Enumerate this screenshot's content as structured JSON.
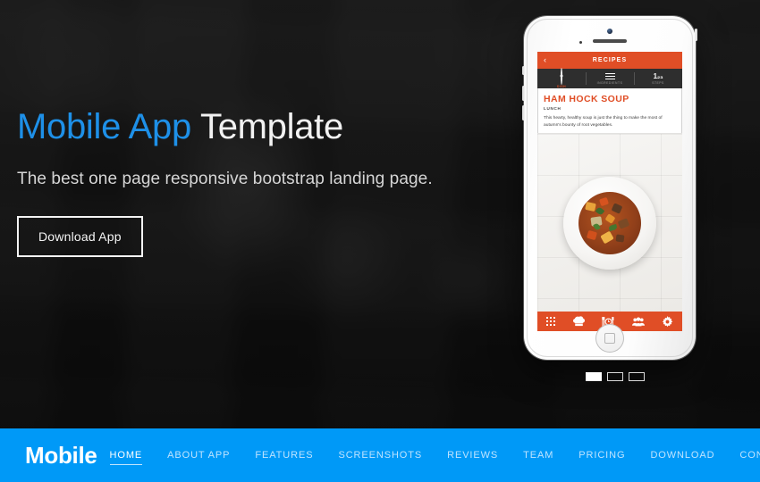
{
  "hero": {
    "headline_accent": "Mobile App",
    "headline_rest": " Template",
    "subheadline": "The best one page responsive bootstrap landing page.",
    "cta_label": "Download App",
    "accent_color": "#1e90e8",
    "background_style": "dark blurred grayscale photo collage"
  },
  "phone": {
    "app": {
      "topbar": {
        "back_icon": "‹",
        "title": "RECIPES",
        "bar_color": "#e04e26"
      },
      "tabs": [
        {
          "label": "DISH",
          "icon": "dish-circle-icon",
          "active": true
        },
        {
          "label": "INGREDIENTS",
          "icon": "list-lines-icon",
          "active": false
        },
        {
          "label": "STEPS",
          "icon": "numbers-123-icon",
          "active": false
        }
      ],
      "recipe": {
        "name": "HAM HOCK SOUP",
        "meal": "LUNCH",
        "description": "This hearty, healthy soup is just the thing to make the most of autumn's bounty of root vegetables.",
        "photo_alt": "bowl of vegetable ham hock soup on a white plate"
      },
      "bottom_nav": [
        {
          "icon": "grid-icon",
          "glyph": ""
        },
        {
          "icon": "chef-hat-icon",
          "glyph": "♟"
        },
        {
          "icon": "cutlery-clock-icon",
          "glyph": "İΟІ"
        },
        {
          "icon": "people-icon",
          "glyph": "὆5"
        },
        {
          "icon": "gear-icon",
          "glyph": "⚙"
        }
      ]
    }
  },
  "slider": {
    "dots": [
      {
        "active": true
      },
      {
        "active": false
      },
      {
        "active": false
      }
    ]
  },
  "navbar": {
    "brand": "Mobile",
    "bar_color": "#0099f7",
    "links": [
      {
        "label": "HOME",
        "active": true
      },
      {
        "label": "ABOUT APP",
        "active": false
      },
      {
        "label": "FEATURES",
        "active": false
      },
      {
        "label": "SCREENSHOTS",
        "active": false
      },
      {
        "label": "REVIEWS",
        "active": false
      },
      {
        "label": "TEAM",
        "active": false
      },
      {
        "label": "PRICING",
        "active": false
      },
      {
        "label": "DOWNLOAD",
        "active": false
      },
      {
        "label": "CONTACT",
        "active": false
      }
    ]
  }
}
